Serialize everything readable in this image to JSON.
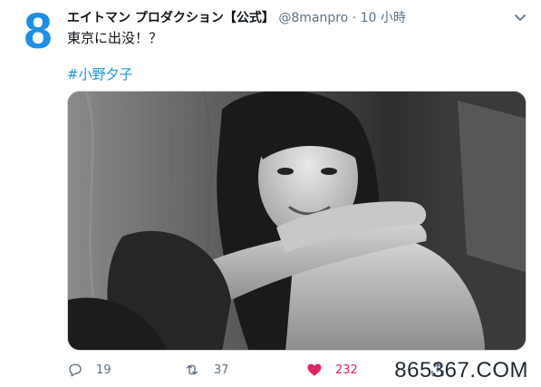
{
  "author": {
    "avatar_glyph": "8",
    "display_name": "エイトマン プロダクション【公式】",
    "handle": "@8manpro",
    "separator": "·",
    "time": "10 小時"
  },
  "tweet": {
    "text": "東京に出没！？",
    "hashtag": "#小野夕子"
  },
  "actions": {
    "reply_count": "19",
    "retweet_count": "37",
    "like_count": "232"
  },
  "watermark": "865367.COM",
  "colors": {
    "brand_blue": "#1d8fe6",
    "link_blue": "#1b95e0",
    "like_red": "#e0245e",
    "muted": "#5b7083"
  },
  "icons": [
    "chevron-down-icon",
    "reply-icon",
    "retweet-icon",
    "like-icon",
    "share-icon"
  ]
}
